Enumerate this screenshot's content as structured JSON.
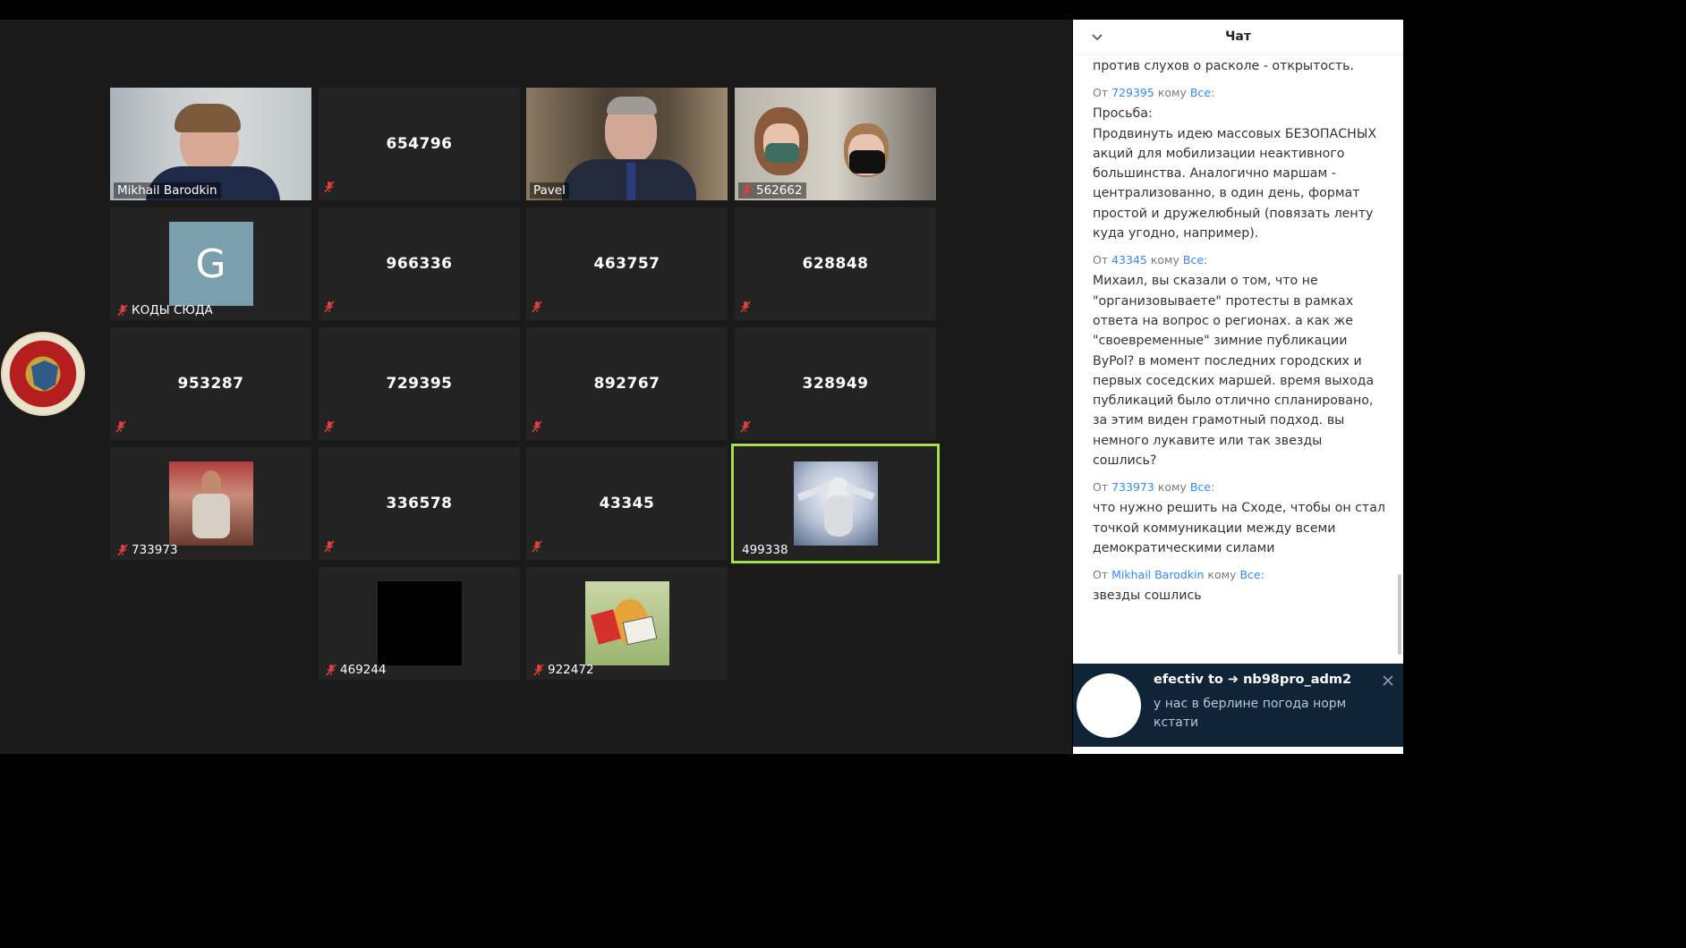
{
  "tiles": [
    {
      "id": "mikhail",
      "label": "Mikhail Barodkin",
      "kind": "video",
      "muted": false
    },
    {
      "id": "654796",
      "label": "654796",
      "kind": "number",
      "muted": true
    },
    {
      "id": "pavel",
      "label": "Pavel",
      "kind": "video",
      "muted": false
    },
    {
      "id": "562662",
      "label": "562662",
      "kind": "video",
      "muted": true
    },
    {
      "id": "kody",
      "label": "КОДЫ СЮДА",
      "kind": "avatar",
      "avatar_letter": "G",
      "muted": true
    },
    {
      "id": "966336",
      "label": "966336",
      "kind": "number",
      "muted": true
    },
    {
      "id": "463757",
      "label": "463757",
      "kind": "number",
      "muted": true
    },
    {
      "id": "628848",
      "label": "628848",
      "kind": "number",
      "muted": true
    },
    {
      "id": "953287",
      "label": "953287",
      "kind": "number",
      "muted": true
    },
    {
      "id": "729395",
      "label": "729395",
      "kind": "number",
      "muted": true
    },
    {
      "id": "892767",
      "label": "892767",
      "kind": "number",
      "muted": true
    },
    {
      "id": "328949",
      "label": "328949",
      "kind": "number",
      "muted": true
    },
    {
      "id": "733973",
      "label": "733973",
      "kind": "picture",
      "muted": true
    },
    {
      "id": "336578",
      "label": "336578",
      "kind": "number",
      "muted": true
    },
    {
      "id": "43345",
      "label": "43345",
      "kind": "number",
      "muted": true
    },
    {
      "id": "499338",
      "label": "499338",
      "kind": "picture",
      "muted": false,
      "active": true
    },
    {
      "id": "469244",
      "label": "469244",
      "kind": "picture",
      "muted": true
    },
    {
      "id": "922472",
      "label": "922472",
      "kind": "picture",
      "muted": true
    }
  ],
  "chat": {
    "title": "Чат",
    "messages": [
      {
        "from": "",
        "to": "",
        "text": "против слухов о расколе - открытость."
      },
      {
        "from": "729395",
        "to": "Все",
        "text": "Просьба:\nПродвинуть идею массовых БЕЗОПАСНЫХ акций для мобилизации неактивного большинства. Аналогично маршам - централизованно, в один день, формат простой и дружелюбный (повязать ленту куда угодно, например)."
      },
      {
        "from": "43345",
        "to": "Все",
        "text": "Михаил, вы сказали о том, что не \"организовываете\" протесты в рамках ответа на вопрос о регионах. а как же \"своевременные\" зимние публикации ByPol? в момент последних городских и первых соседских маршей. время выхода публикаций было отлично спланировано, за этим виден грамотный подход. вы немного лукавите или так звезды сошлись?"
      },
      {
        "from": "733973",
        "to": "Все",
        "text": "что нужно решить на Сходе, чтобы он стал точкой коммуникации между всеми демократическими силами"
      },
      {
        "from": "Mikhail Barodkin",
        "to": "Все",
        "text": "звезды сошлись"
      }
    ],
    "from_word": "От",
    "to_word": "кому"
  },
  "notification": {
    "sender": "efectiv to ➜ nb98pro_adm2",
    "text": "у нас в берлине погода норм кстати"
  },
  "colors": {
    "accent": "#2d8cff",
    "active_speaker": "#a7e04a",
    "tile_bg": "#232323",
    "mute": "#e0413a"
  }
}
